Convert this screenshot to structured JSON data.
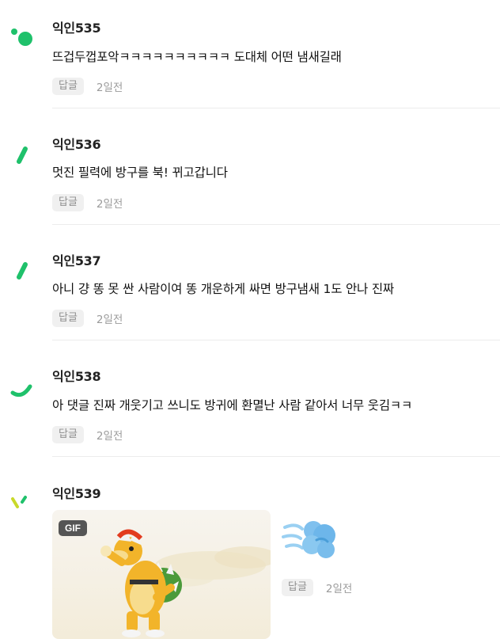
{
  "comments": [
    {
      "author": "익인535",
      "text": "뜨겁두껍포악ㅋㅋㅋㅋㅋㅋㅋㅋㅋㅋ 도대체 어떤 냄새길래",
      "reply": "답글",
      "time": "2일전"
    },
    {
      "author": "익인536",
      "text": "멋진 필력에 방구를 북! 뀌고갑니다",
      "reply": "답글",
      "time": "2일전"
    },
    {
      "author": "익인537",
      "text": "아니 걍 똥 못 싼 사람이여 똥 개운하게 싸면 방구냄새 1도 안나 진짜",
      "reply": "답글",
      "time": "2일전"
    },
    {
      "author": "익인538",
      "text": "아 댓글 진짜 개웃기고 쓰니도 방귀에 환멸난 사람 같아서 너무 웃김ㅋㅋ",
      "reply": "답글",
      "time": "2일전"
    },
    {
      "author": "익인539",
      "gif_badge": "GIF",
      "reply": "답글",
      "time": "2일전"
    }
  ],
  "icons": {
    "avatar_535": "green-dots-avatar-icon",
    "avatar_536": "green-dash-avatar-icon",
    "avatar_537": "green-dash-avatar-icon",
    "avatar_538": "green-curve-avatar-icon",
    "avatar_539": "green-yellow-ticks-avatar-icon",
    "emoji": "dashing-away-emoji-icon"
  },
  "colors": {
    "accent": "#1fc16b",
    "reply_bg": "#f0f0f0",
    "meta_text": "#9b9b9b"
  }
}
